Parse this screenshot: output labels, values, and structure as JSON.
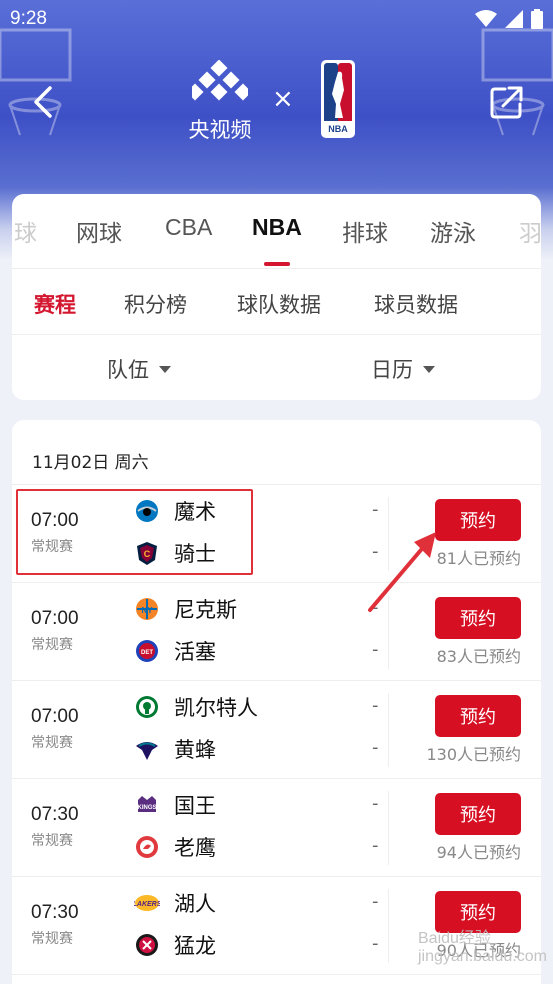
{
  "status_bar": {
    "time": "9:28"
  },
  "header": {
    "brand_name": "央视频",
    "times": "×",
    "nba_logo_text": "NBA"
  },
  "sport_tabs": [
    {
      "label": "球"
    },
    {
      "label": "网球"
    },
    {
      "label": "CBA"
    },
    {
      "label": "NBA"
    },
    {
      "label": "排球"
    },
    {
      "label": "游泳"
    },
    {
      "label": "羽"
    }
  ],
  "sub_tabs": [
    {
      "label": "赛程"
    },
    {
      "label": "积分榜"
    },
    {
      "label": "球队数据"
    },
    {
      "label": "球员数据"
    }
  ],
  "filters": {
    "team": "队伍",
    "calendar": "日历"
  },
  "schedule": {
    "date": "11月02日 周六",
    "games": [
      {
        "time": "07:00",
        "type": "常规赛",
        "team1": "魔术",
        "team2": "骑士",
        "score1": "-",
        "score2": "-",
        "button": "预约",
        "reserved": "81人已预约",
        "logo1_color": "#0077c0",
        "logo2_color": "#6f263d"
      },
      {
        "time": "07:00",
        "type": "常规赛",
        "team1": "尼克斯",
        "team2": "活塞",
        "score1": "-",
        "score2": "-",
        "button": "预约",
        "reserved": "83人已预约",
        "logo1_color": "#f58426",
        "logo2_color": "#c8102e"
      },
      {
        "time": "07:00",
        "type": "常规赛",
        "team1": "凯尔特人",
        "team2": "黄蜂",
        "score1": "-",
        "score2": "-",
        "button": "预约",
        "reserved": "130人已预约",
        "logo1_color": "#007a33",
        "logo2_color": "#1d1160"
      },
      {
        "time": "07:30",
        "type": "常规赛",
        "team1": "国王",
        "team2": "老鹰",
        "score1": "-",
        "score2": "-",
        "button": "预约",
        "reserved": "94人已预约",
        "logo1_color": "#5a2d81",
        "logo2_color": "#e03a3e"
      },
      {
        "time": "07:30",
        "type": "常规赛",
        "team1": "湖人",
        "team2": "猛龙",
        "score1": "-",
        "score2": "-",
        "button": "预约",
        "reserved": "90人已预约",
        "logo1_color": "#fdb927",
        "logo2_color": "#1a1a1a"
      }
    ]
  },
  "watermark": "Baidu经验\njingyan.baidu.com",
  "colors": {
    "accent": "#d60f22",
    "header": "#3e50c6"
  }
}
